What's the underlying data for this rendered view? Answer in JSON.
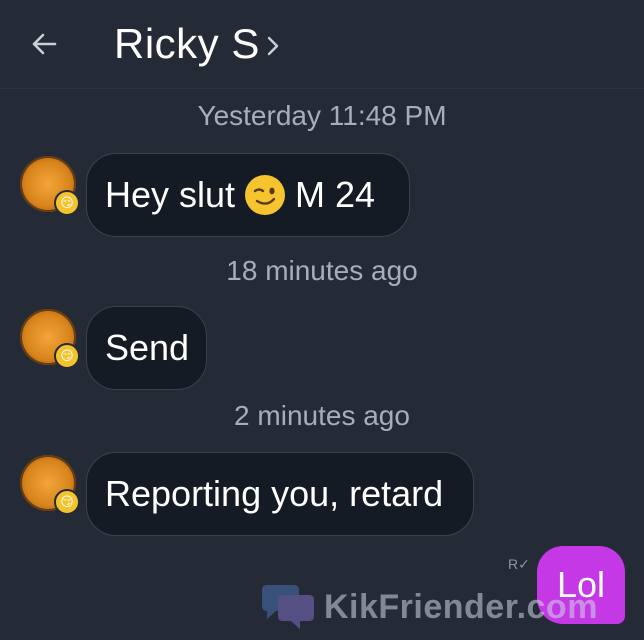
{
  "header": {
    "title": "Ricky S"
  },
  "messages": {
    "ts1": "Yesterday 11:48 PM",
    "msg1_before": "Hey slut",
    "msg1_after": "M 24",
    "ts2": "18 minutes ago",
    "msg2": "Send",
    "ts3": "2 minutes ago",
    "msg3": "Reporting you, retard",
    "receipt": "R",
    "outgoing": "Lol"
  },
  "icons": {
    "back": "back-arrow-icon",
    "chevron": "chevron-right-icon",
    "wink": "winking-face-icon",
    "badge": "smirk-face-icon"
  },
  "colors": {
    "background": "#252b36",
    "incoming_bubble": "#151b24",
    "outgoing_bubble": "#c538e6",
    "timestamp": "#a7adbd"
  },
  "watermark": {
    "text": "KikFriender.com"
  }
}
